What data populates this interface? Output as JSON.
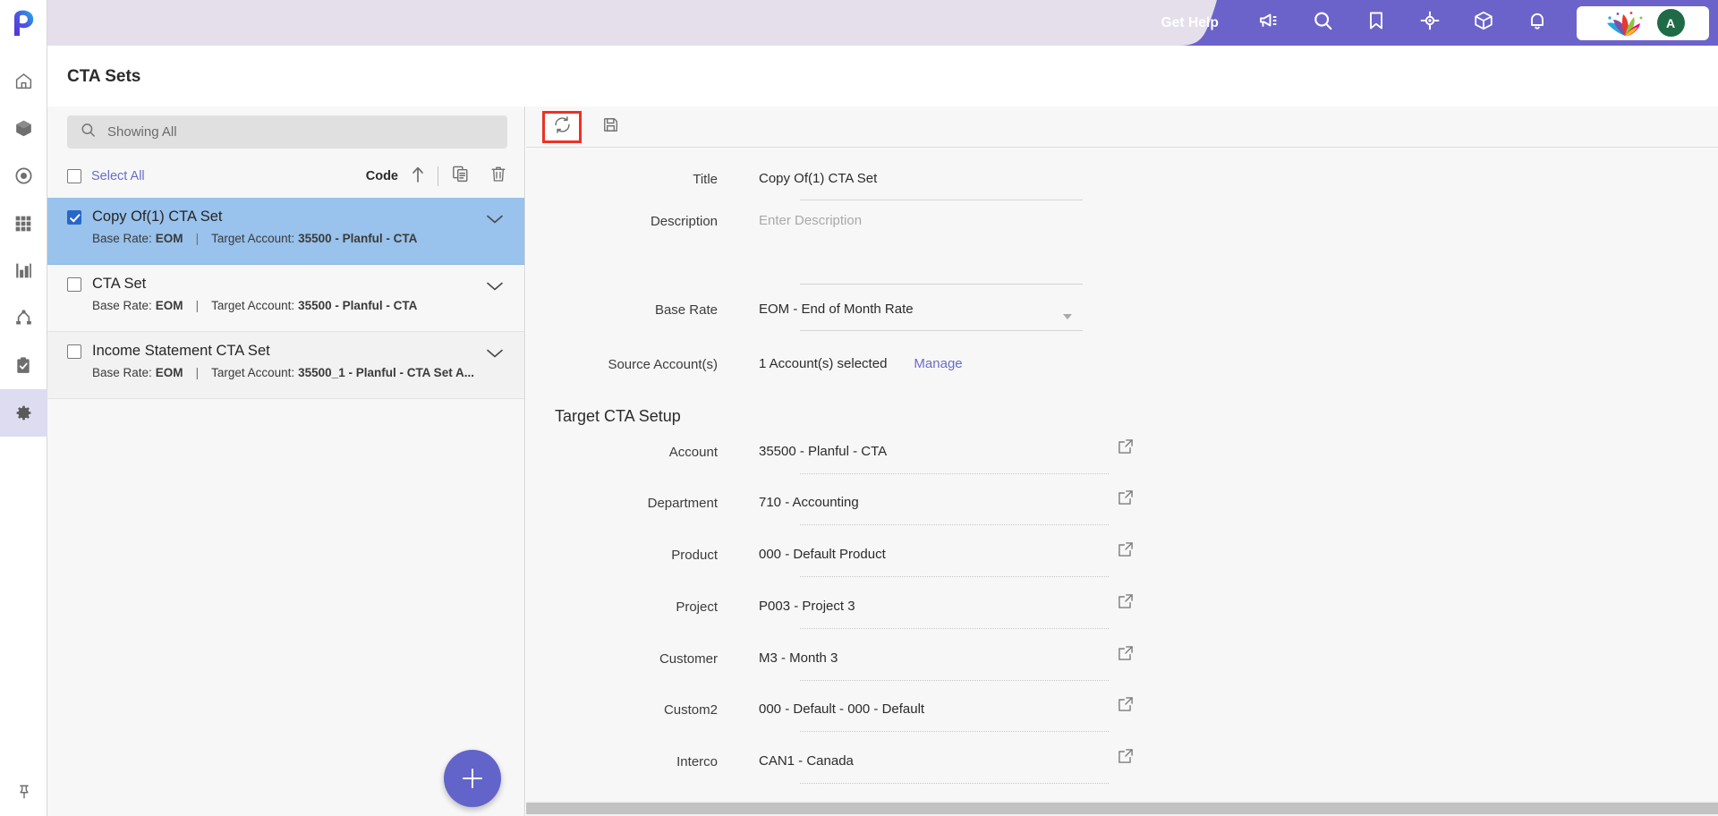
{
  "app": {
    "logo": "planful-p-logo",
    "accent_purple": "#6264c9",
    "header_band": "#e4dfeb"
  },
  "rail": {
    "items": [
      {
        "name": "home",
        "icon": "home-icon"
      },
      {
        "name": "package",
        "icon": "cube-icon"
      },
      {
        "name": "target",
        "icon": "target-dot-icon"
      },
      {
        "name": "grid",
        "icon": "grid-icon"
      },
      {
        "name": "reports",
        "icon": "bar-chart-icon"
      },
      {
        "name": "hierarchy",
        "icon": "sitemap-icon"
      },
      {
        "name": "tasks",
        "icon": "clipboard-check-icon"
      },
      {
        "name": "settings",
        "icon": "gear-icon",
        "active": true
      }
    ],
    "pin": {
      "name": "pin",
      "icon": "pushpin-icon"
    }
  },
  "header": {
    "get_help": "Get Help",
    "icons": [
      {
        "name": "announcements",
        "icon": "megaphone-icon"
      },
      {
        "name": "search",
        "icon": "search-icon"
      },
      {
        "name": "bookmarks",
        "icon": "bookmark-icon"
      },
      {
        "name": "navigator",
        "icon": "crosshair-icon"
      },
      {
        "name": "packages",
        "icon": "box-icon"
      },
      {
        "name": "notifications",
        "icon": "bell-icon"
      }
    ],
    "brand_logo": "lotus-logo",
    "avatar_initial": "A",
    "avatar_color": "#1f6b47"
  },
  "page": {
    "title": "CTA Sets"
  },
  "list_panel": {
    "search": {
      "placeholder": "Showing All",
      "value": "",
      "icon": "search-icon"
    },
    "toolbar": {
      "select_all_label": "Select All",
      "select_all_checked": false,
      "sort_label": "Code",
      "sort_direction_icon": "arrow-up-icon",
      "copy_icon": "copy-icon",
      "delete_icon": "trash-icon"
    },
    "items": [
      {
        "title": "Copy Of(1) CTA Set",
        "base_rate_label": "Base Rate:",
        "base_rate_value": "EOM",
        "separator": "|",
        "target_account_label": "Target Account:",
        "target_account_value": "35500 - Planful - CTA",
        "checked": true,
        "selected": true
      },
      {
        "title": "CTA Set",
        "base_rate_label": "Base Rate:",
        "base_rate_value": "EOM",
        "separator": "|",
        "target_account_label": "Target Account:",
        "target_account_value": "35500 - Planful - CTA",
        "checked": false,
        "selected": false
      },
      {
        "title": "Income Statement CTA Set",
        "base_rate_label": "Base Rate:",
        "base_rate_value": "EOM",
        "separator": "|",
        "target_account_label": "Target Account:",
        "target_account_value": "35500_1 - Planful - CTA Set A...",
        "checked": false,
        "selected": false
      }
    ],
    "add_button": {
      "label": "+",
      "name": "add-cta-set"
    }
  },
  "detail": {
    "toolbar": {
      "refresh": {
        "icon": "refresh-icon",
        "highlighted": true,
        "highlight_color": "#ee3124"
      },
      "save": {
        "icon": "save-floppy-icon",
        "highlighted": false
      }
    },
    "fields": {
      "title": {
        "label": "Title",
        "value": "Copy Of(1) CTA Set"
      },
      "description": {
        "label": "Description",
        "value": "",
        "placeholder": "Enter Description"
      },
      "base_rate": {
        "label": "Base Rate",
        "value": "EOM - End of Month Rate",
        "caret": "chevron-down-icon"
      },
      "source_accounts": {
        "label": "Source Account(s)",
        "value": "1 Account(s) selected",
        "action_label": "Manage"
      }
    },
    "section": {
      "heading": "Target CTA Setup"
    },
    "setup_rows": [
      {
        "label": "Account",
        "value": "35500 - Planful - CTA",
        "icon": "external-link-icon"
      },
      {
        "label": "Department",
        "value": "710 - Accounting",
        "icon": "external-link-icon"
      },
      {
        "label": "Product",
        "value": "000 - Default Product",
        "icon": "external-link-icon"
      },
      {
        "label": "Project",
        "value": "P003 - Project 3",
        "icon": "external-link-icon"
      },
      {
        "label": "Customer",
        "value": "M3 - Month 3",
        "icon": "external-link-icon"
      },
      {
        "label": "Custom2",
        "value": "000 - Default - 000 - Default",
        "icon": "external-link-icon"
      },
      {
        "label": "Interco",
        "value": "CAN1 - Canada",
        "icon": "external-link-icon"
      }
    ]
  }
}
